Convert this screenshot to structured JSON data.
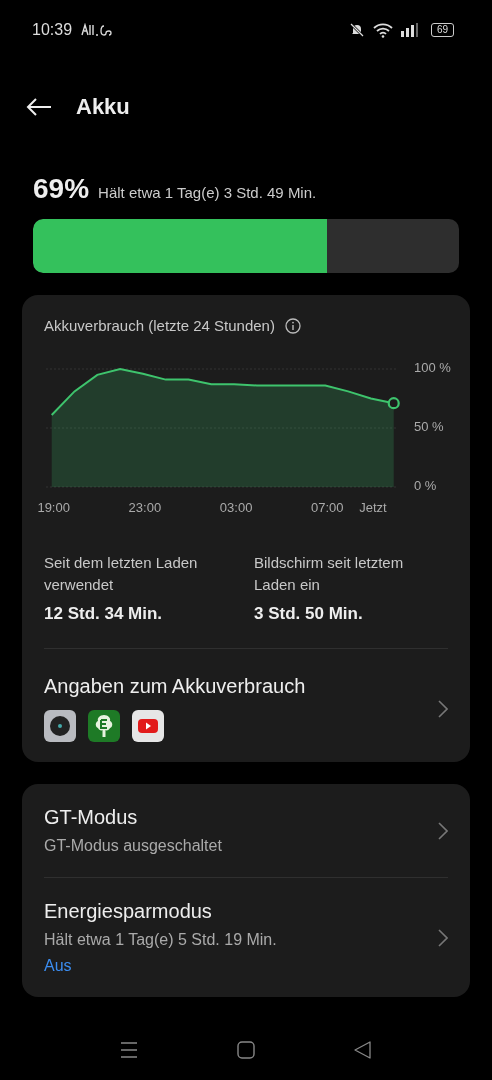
{
  "status_bar": {
    "time": "10:39",
    "battery": "69"
  },
  "header": {
    "title": "Akku"
  },
  "battery": {
    "percent": "69%",
    "estimate": "Hält etwa 1 Tag(e) 3 Std. 49 Min.",
    "level": 0.69
  },
  "usage_card": {
    "title": "Akkuverbrauch (letzte 24 Stunden)",
    "chart_data": {
      "type": "area",
      "categories": [
        "19:00",
        null,
        null,
        null,
        "23:00",
        null,
        null,
        null,
        "03:00",
        null,
        null,
        null,
        "07:00",
        null,
        "Jetzt",
        null
      ],
      "series": [
        {
          "color": "#3ec46d",
          "values": [
            61,
            81,
            95,
            100,
            96,
            91,
            91,
            87,
            87,
            86,
            86,
            86,
            86,
            81,
            75,
            71
          ]
        }
      ],
      "ylim": [
        0,
        100
      ],
      "yticks": [
        {
          "value": 100,
          "label": "100 %"
        },
        {
          "value": 50,
          "label": "50 %"
        },
        {
          "value": 0,
          "label": "0 %"
        }
      ]
    },
    "stats": [
      {
        "label": "Seit dem letzten Laden verwendet",
        "value": "12 Std. 34 Min."
      },
      {
        "label": "Bildschirm seit letztem Laden ein",
        "value": "3 Std. 50 Min."
      }
    ],
    "details": {
      "title": "Angaben zum Akkuverbrauch",
      "apps": [
        {
          "kind": "camera"
        },
        {
          "kind": "tree"
        },
        {
          "kind": "video"
        }
      ]
    }
  },
  "settings": [
    {
      "title": "GT-Modus",
      "subtitle": "GT-Modus ausgeschaltet"
    },
    {
      "title": "Energiesparmodus",
      "subtitle": "Hält etwa 1 Tag(e) 5 Std. 19 Min.",
      "status": "Aus"
    }
  ]
}
